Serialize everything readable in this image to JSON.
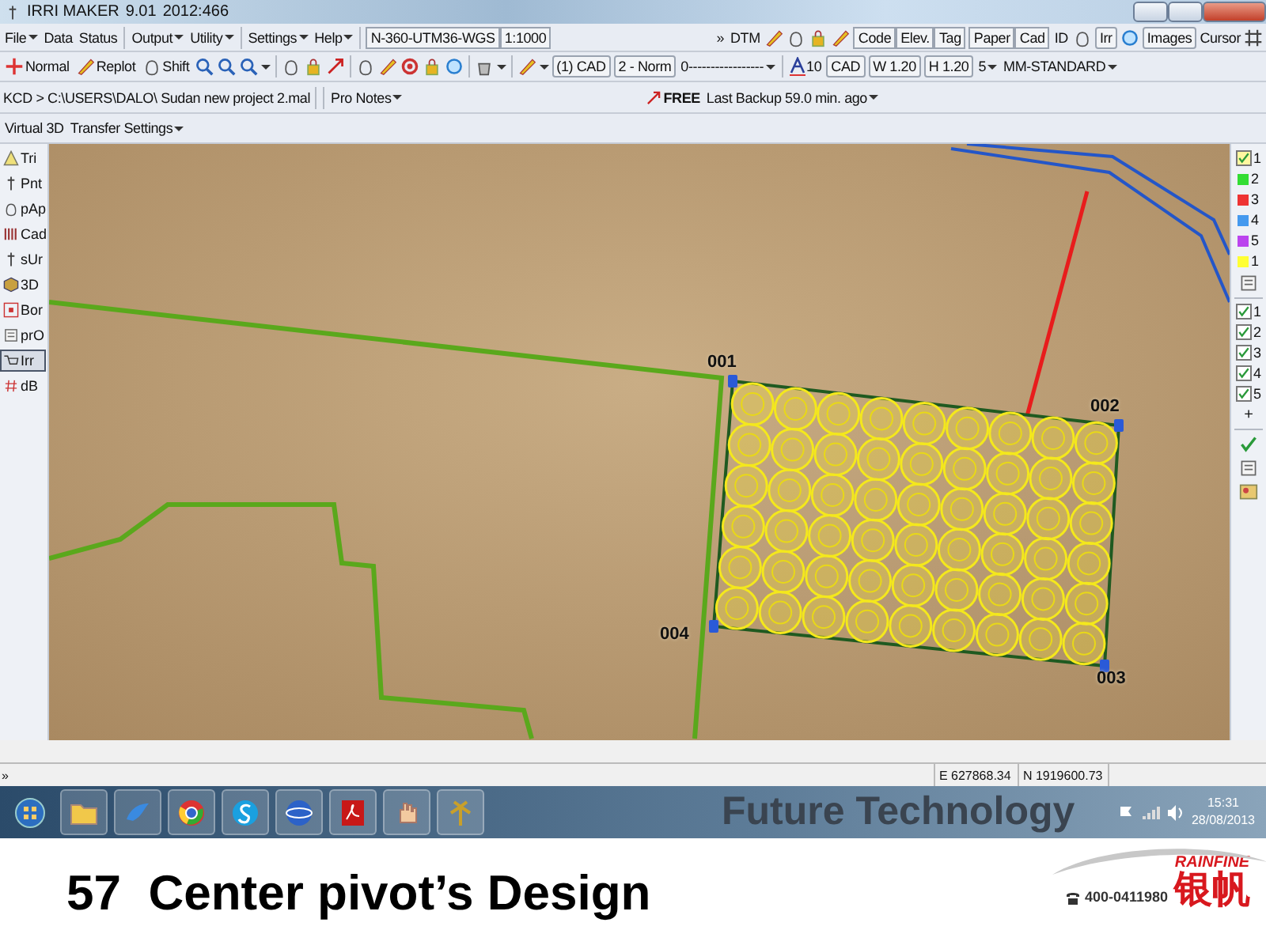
{
  "window": {
    "title": "IRRI MAKER",
    "version": "9.01",
    "build": "2012:466"
  },
  "menu": [
    {
      "label": "File",
      "dropdown": true
    },
    {
      "label": "Data",
      "dropdown": false
    },
    {
      "label": "Status",
      "dropdown": false
    },
    {
      "label": "Output",
      "dropdown": true
    },
    {
      "label": "Utility",
      "dropdown": true
    },
    {
      "label": "Settings",
      "dropdown": true
    },
    {
      "label": "Help",
      "dropdown": true
    }
  ],
  "projection": "N-360-UTM36-WGS",
  "scale": "1:1000",
  "overflow": "»",
  "dtm": "DTM",
  "view_buttons": [
    [
      "Code",
      "Elev.",
      "Tag"
    ],
    [
      "Paper",
      "Cad"
    ]
  ],
  "id_label": "ID",
  "irr": "Irr",
  "images": "Images",
  "cursor": "Cursor",
  "tools": [
    "Normal",
    "Replot",
    "Shift"
  ],
  "layer": "(1) CAD",
  "line_style": "2 - Norm",
  "line_type": "0-----------------",
  "text_size": "10",
  "text_layer": "CAD",
  "width": "W 1.20",
  "height": "H 1.20",
  "decimals": "5",
  "font": "MM-STANDARD",
  "path": "KCD > C:\\USERS\\DALO\\ Sudan new project 2.mal",
  "notes": "Pro Notes",
  "license": "FREE",
  "backup": "Last Backup 59.0 min. ago",
  "menus2": [
    "Virtual 3D",
    "Transfer Settings"
  ],
  "left_tools": [
    {
      "label": "Tri",
      "selected": false
    },
    {
      "label": "Pnt",
      "selected": false
    },
    {
      "label": "pAp",
      "selected": false
    },
    {
      "label": "Cad",
      "selected": false
    },
    {
      "label": "sUr",
      "selected": false
    },
    {
      "label": "3D",
      "selected": false
    },
    {
      "label": "Bor",
      "selected": false
    },
    {
      "label": "prO",
      "selected": false
    },
    {
      "label": "Irr",
      "selected": true
    },
    {
      "label": "dB",
      "selected": false
    }
  ],
  "layers": [
    {
      "label": "1",
      "kind": "check",
      "checked": true
    },
    {
      "label": "2",
      "kind": "swatch",
      "color": "#33dd33"
    },
    {
      "label": "3",
      "kind": "swatch",
      "color": "#ee3333"
    },
    {
      "label": "4",
      "kind": "swatch",
      "color": "#4499ee"
    },
    {
      "label": "5",
      "kind": "swatch",
      "color": "#bb44ee"
    },
    {
      "label": "1",
      "kind": "swatch",
      "color": "#ffff33"
    }
  ],
  "layer_checks": [
    {
      "label": "1",
      "checked": true
    },
    {
      "label": "2",
      "checked": true
    },
    {
      "label": "3",
      "checked": true
    },
    {
      "label": "4",
      "checked": true
    },
    {
      "label": "5",
      "checked": true
    }
  ],
  "add": "+",
  "map": {
    "points": [
      {
        "label": "001"
      },
      {
        "label": "002"
      },
      {
        "label": "003"
      },
      {
        "label": "004"
      }
    ]
  },
  "status_bar": {
    "overflow": "»",
    "easting": "E 627868.34",
    "northing": "N 1919600.73"
  },
  "taskbar": {
    "wallpaper_text": "Future Technology",
    "time": "15:31",
    "date": "28/08/2013"
  },
  "slide": {
    "caption": "57  Center pivot’s Design",
    "phone": "400-0411980",
    "brand": "RAINFINE",
    "brand_cn": "银帆"
  }
}
